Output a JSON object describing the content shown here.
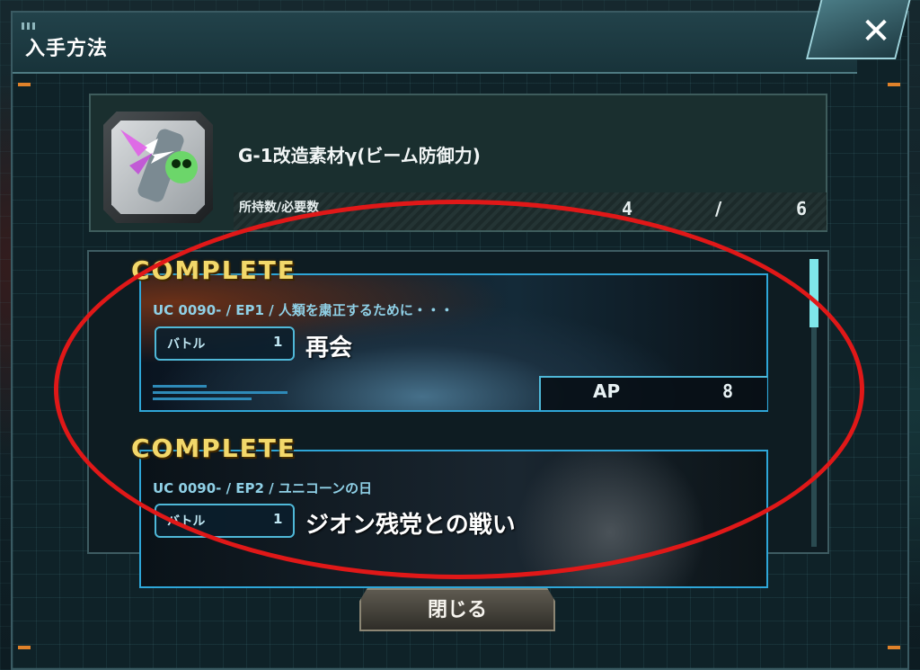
{
  "dialog": {
    "title": "入手方法",
    "close_icon": "close-icon"
  },
  "item": {
    "name": "G-1改造素材γ(ビーム防御力)",
    "owned_label": "所持数/必要数",
    "owned": "4",
    "separator": "/",
    "required": "6",
    "icon": "beam-material-icon"
  },
  "stages": [
    {
      "status": "COMPLETE",
      "chapter": "UC 0090- / EP1 / 人類を粛正するために・・・",
      "battle_label": "バトル",
      "battle_number": "1",
      "title": "再会",
      "ap_label": "AP",
      "ap_value": "8"
    },
    {
      "status": "COMPLETE",
      "chapter": "UC 0090- / EP2 / ユニコーンの日",
      "battle_label": "バトル",
      "battle_number": "1",
      "title": "ジオン残党との戦い"
    }
  ],
  "footer": {
    "close_label": "閉じる"
  },
  "colors": {
    "accent": "#2ea6d8",
    "complete": "#f3d86a",
    "annotation": "#e01818"
  }
}
